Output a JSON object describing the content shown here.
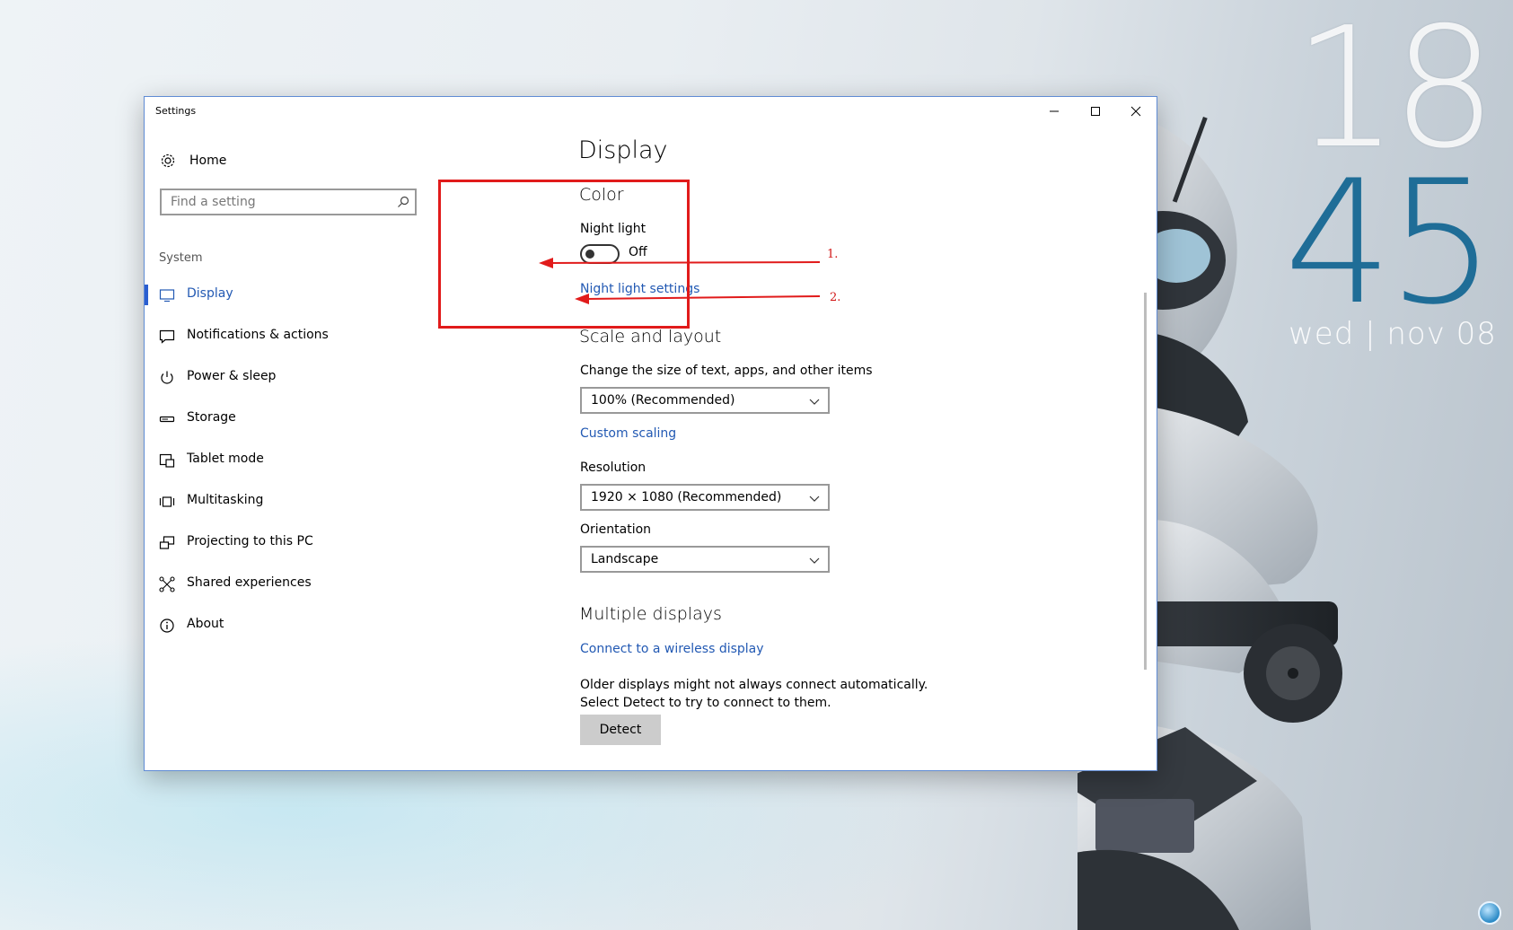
{
  "desktop": {
    "clock": {
      "hour": "18",
      "minute": "45",
      "date": "wed | nov 08"
    },
    "colors": {
      "clock_minute": "#1f6d97"
    }
  },
  "window": {
    "title": "Settings",
    "controls": {
      "minimize_icon": "minimize-icon",
      "maximize_icon": "maximize-icon",
      "close_icon": "close-icon"
    }
  },
  "nav": {
    "home_label": "Home",
    "search_placeholder": "Find a setting",
    "group_label": "System",
    "items": [
      {
        "label": "Display",
        "icon": "monitor-icon",
        "active": true
      },
      {
        "label": "Notifications & actions",
        "icon": "notification-icon",
        "active": false
      },
      {
        "label": "Power & sleep",
        "icon": "power-icon",
        "active": false
      },
      {
        "label": "Storage",
        "icon": "storage-icon",
        "active": false
      },
      {
        "label": "Tablet mode",
        "icon": "tablet-mode-icon",
        "active": false
      },
      {
        "label": "Multitasking",
        "icon": "multitasking-icon",
        "active": false
      },
      {
        "label": "Projecting to this PC",
        "icon": "projecting-icon",
        "active": false
      },
      {
        "label": "Shared experiences",
        "icon": "shared-experiences-icon",
        "active": false
      },
      {
        "label": "About",
        "icon": "info-icon",
        "active": false
      }
    ],
    "colors": {
      "accent": "#2a5ed0",
      "active_text": "#2259b3"
    }
  },
  "content": {
    "title": "Display",
    "color": {
      "heading": "Color",
      "night_light_label": "Night light",
      "night_light_state": "Off",
      "night_light_settings_link": "Night light settings"
    },
    "scale": {
      "heading": "Scale and layout",
      "size_label": "Change the size of text, apps, and other items",
      "size_value": "100% (Recommended)",
      "custom_scaling_link": "Custom scaling",
      "resolution_label": "Resolution",
      "resolution_value": "1920 × 1080 (Recommended)",
      "orientation_label": "Orientation",
      "orientation_value": "Landscape"
    },
    "multiple": {
      "heading": "Multiple displays",
      "wireless_link": "Connect to a wireless display",
      "description": "Older displays might not always connect automatically. Select Detect to try to connect to them.",
      "detect_button": "Detect"
    },
    "colors": {
      "link": "#2259b3"
    }
  },
  "annotations": {
    "step1": "1.",
    "step2": "2.",
    "color": "#e11b1b"
  }
}
